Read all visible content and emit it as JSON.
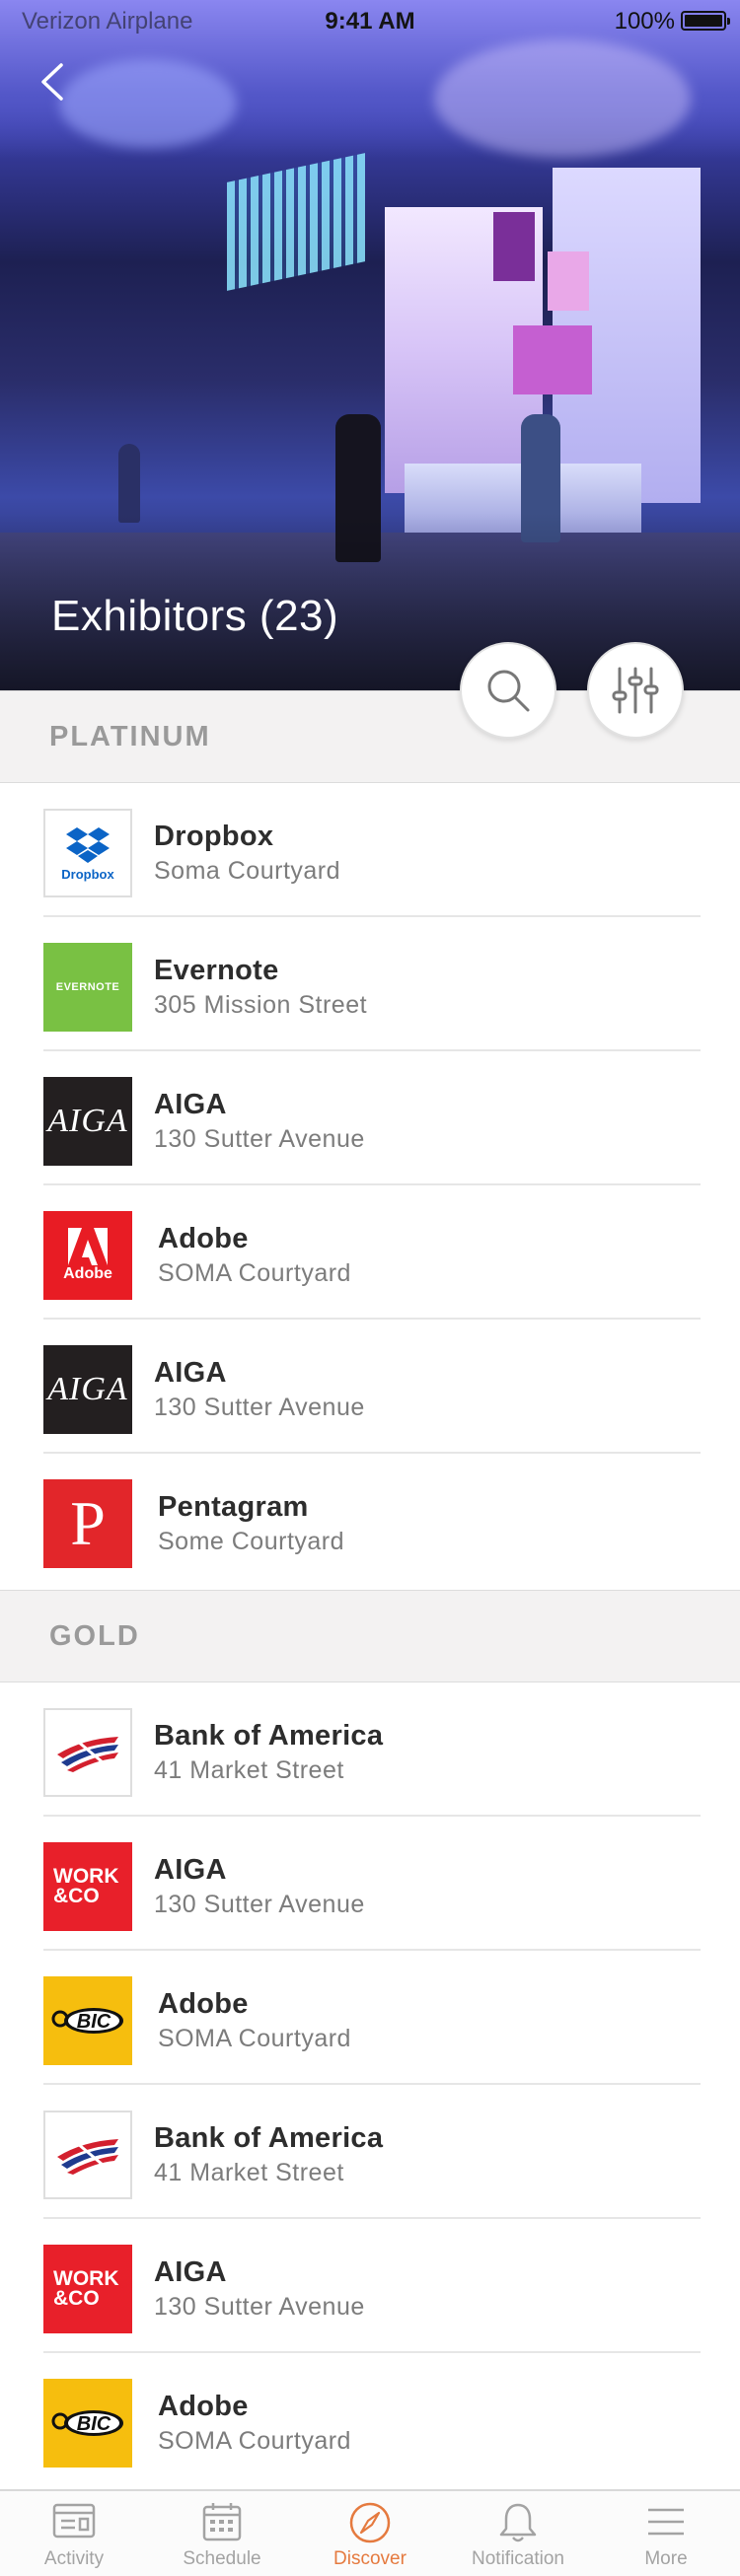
{
  "status_bar": {
    "carrier": "Verizon Airplane",
    "time": "9:41 AM",
    "battery": "100%"
  },
  "header": {
    "title": "Exhibitors (23)"
  },
  "sections": {
    "platinum": {
      "title": "PLATINUM",
      "items": [
        {
          "name": "Dropbox",
          "address": "Soma Courtyard",
          "logo": "Dropbox"
        },
        {
          "name": "Evernote",
          "address": "305 Mission Street",
          "logo": "EVERNOTE"
        },
        {
          "name": "AIGA",
          "address": "130 Sutter Avenue",
          "logo": "AIGA"
        },
        {
          "name": "Adobe",
          "address": "SOMA Courtyard",
          "logo": "Adobe"
        },
        {
          "name": "AIGA",
          "address": "130 Sutter Avenue",
          "logo": "AIGA"
        },
        {
          "name": "Pentagram",
          "address": "Some Courtyard",
          "logo": "P"
        }
      ]
    },
    "gold": {
      "title": "GOLD",
      "items": [
        {
          "name": "Bank of America",
          "address": "41 Market Street"
        },
        {
          "name": "AIGA",
          "address": "130 Sutter Avenue",
          "logo": "WORK &CO"
        },
        {
          "name": "Adobe",
          "address": "SOMA Courtyard",
          "logo": "BIC"
        },
        {
          "name": "Bank of America",
          "address": "41 Market Street"
        },
        {
          "name": "AIGA",
          "address": "130 Sutter Avenue",
          "logo": "WORK &CO"
        },
        {
          "name": "Adobe",
          "address": "SOMA Courtyard",
          "logo": "BIC"
        }
      ]
    }
  },
  "tabbar": {
    "active": "Discover",
    "active_color": "#e57a3f",
    "tabs": [
      {
        "label": "Activity",
        "icon": "activity-icon"
      },
      {
        "label": "Schedule",
        "icon": "calendar-icon"
      },
      {
        "label": "Discover",
        "icon": "compass-icon"
      },
      {
        "label": "Notification",
        "icon": "bell-icon"
      },
      {
        "label": "More",
        "icon": "menu-icon"
      }
    ]
  }
}
